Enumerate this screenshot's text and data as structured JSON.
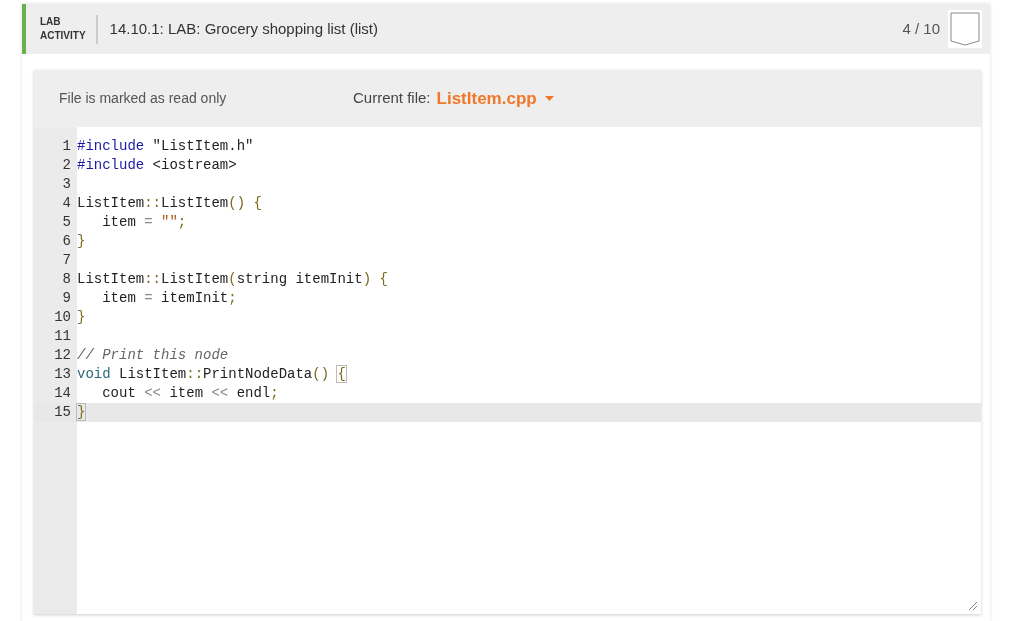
{
  "header": {
    "tag_lines": [
      "LAB",
      "ACTIVITY"
    ],
    "title": "14.10.1: LAB: Grocery shopping list (list)",
    "progress": "4 / 10"
  },
  "editor": {
    "read_only_note": "File is marked as read only",
    "current_file_label": "Current file:",
    "current_file": "ListItem.cpp",
    "lines": [
      {
        "number": "1",
        "selected": false,
        "tokens": [
          {
            "kind": "keyword",
            "text": "#include"
          },
          {
            "kind": "plain",
            "text": " \"ListItem.h\""
          }
        ]
      },
      {
        "number": "2",
        "selected": false,
        "tokens": [
          {
            "kind": "keyword",
            "text": "#include"
          },
          {
            "kind": "plain",
            "text": " <iostream>"
          }
        ]
      },
      {
        "number": "3",
        "selected": false
      },
      {
        "number": "4",
        "selected": false,
        "tokens": [
          {
            "kind": "plain",
            "text": "ListItem"
          },
          {
            "kind": "punct",
            "text": "::"
          },
          {
            "kind": "plain",
            "text": "ListItem"
          },
          {
            "kind": "punct",
            "text": "() {"
          }
        ]
      },
      {
        "number": "5",
        "selected": false,
        "tokens": [
          {
            "kind": "plain",
            "text": "   item "
          },
          {
            "kind": "operator",
            "text": "= "
          },
          {
            "kind": "string",
            "text": "\"\""
          },
          {
            "kind": "punct",
            "text": ";"
          }
        ]
      },
      {
        "number": "6",
        "selected": false,
        "tokens": [
          {
            "kind": "punct",
            "text": "}"
          }
        ]
      },
      {
        "number": "7",
        "selected": false
      },
      {
        "number": "8",
        "selected": false,
        "tokens": [
          {
            "kind": "plain",
            "text": "ListItem"
          },
          {
            "kind": "punct",
            "text": "::"
          },
          {
            "kind": "plain",
            "text": "ListItem"
          },
          {
            "kind": "punct",
            "text": "("
          },
          {
            "kind": "plain",
            "text": "string itemInit"
          },
          {
            "kind": "punct",
            "text": ") {"
          }
        ]
      },
      {
        "number": "9",
        "selected": false,
        "tokens": [
          {
            "kind": "plain",
            "text": "   item "
          },
          {
            "kind": "operator",
            "text": "="
          },
          {
            "kind": "plain",
            "text": " itemInit"
          },
          {
            "kind": "punct",
            "text": ";"
          }
        ]
      },
      {
        "number": "10",
        "selected": false,
        "tokens": [
          {
            "kind": "punct",
            "text": "}"
          }
        ]
      },
      {
        "number": "11",
        "selected": false
      },
      {
        "number": "12",
        "selected": false,
        "tokens": [
          {
            "kind": "comment",
            "text": "// Print this node"
          }
        ]
      },
      {
        "number": "13",
        "selected": false,
        "tokens": [
          {
            "kind": "type",
            "text": "void"
          },
          {
            "kind": "plain",
            "text": " ListItem"
          },
          {
            "kind": "punct",
            "text": "::"
          },
          {
            "kind": "plain",
            "text": "PrintNodeData"
          },
          {
            "kind": "punct",
            "text": "() "
          },
          {
            "kind": "matched",
            "text": "{"
          }
        ]
      },
      {
        "number": "14",
        "selected": false,
        "tokens": [
          {
            "kind": "plain",
            "text": "   cout "
          },
          {
            "kind": "operator",
            "text": "<<"
          },
          {
            "kind": "plain",
            "text": " item "
          },
          {
            "kind": "operator",
            "text": "<<"
          },
          {
            "kind": "plain",
            "text": " endl"
          },
          {
            "kind": "punct",
            "text": ";"
          }
        ]
      },
      {
        "number": "15",
        "selected": true,
        "tokens": [
          {
            "kind": "matched",
            "text": "}"
          }
        ]
      }
    ]
  }
}
